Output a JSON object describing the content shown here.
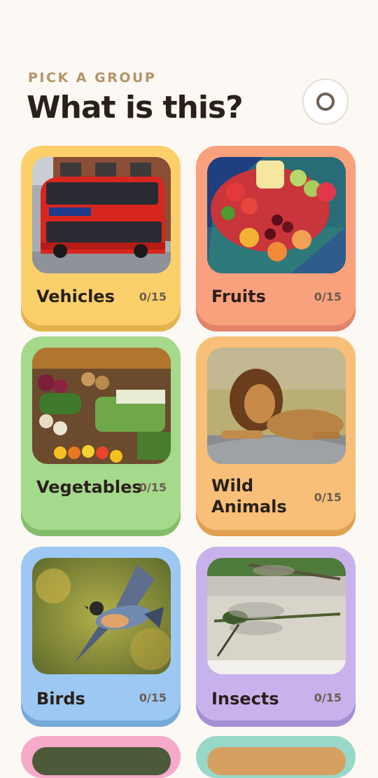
{
  "header": {
    "subtitle": "PICK A GROUP",
    "title": "What is this?"
  },
  "settings": {
    "icon": "circle-settings-icon"
  },
  "categories": [
    {
      "name": "Vehicles",
      "progress": "0/15",
      "color": "#FBD06B",
      "shadow": "#E2B24B",
      "photo": "red-double-decker-bus"
    },
    {
      "name": "Fruits",
      "progress": "0/15",
      "color": "#F9A07D",
      "shadow": "#E3836A",
      "photo": "fruit-platter"
    },
    {
      "name": "Vegetables",
      "progress": "0/15",
      "color": "#A5D98C",
      "shadow": "#83BD69",
      "photo": "vegetable-market"
    },
    {
      "name": "Wild Animals",
      "name_line1": "Wild",
      "name_line2": "Animals",
      "progress": "0/15",
      "color": "#F8BF78",
      "shadow": "#E0A053",
      "photo": "lion-on-rock"
    },
    {
      "name": "Birds",
      "progress": "0/15",
      "color": "#9CC8F3",
      "shadow": "#77A8DA",
      "photo": "bird-in-flight"
    },
    {
      "name": "Insects",
      "progress": "0/15",
      "color": "#C8B2EC",
      "shadow": "#A58FD3",
      "photo": "dragonflies"
    },
    {
      "name": "",
      "progress": "",
      "color": "#F6A9C9",
      "shadow": "#E08AAE",
      "photo": "partial-card"
    },
    {
      "name": "",
      "progress": "",
      "color": "#98D8C9",
      "shadow": "#72BAA8",
      "photo": "partial-card"
    }
  ]
}
